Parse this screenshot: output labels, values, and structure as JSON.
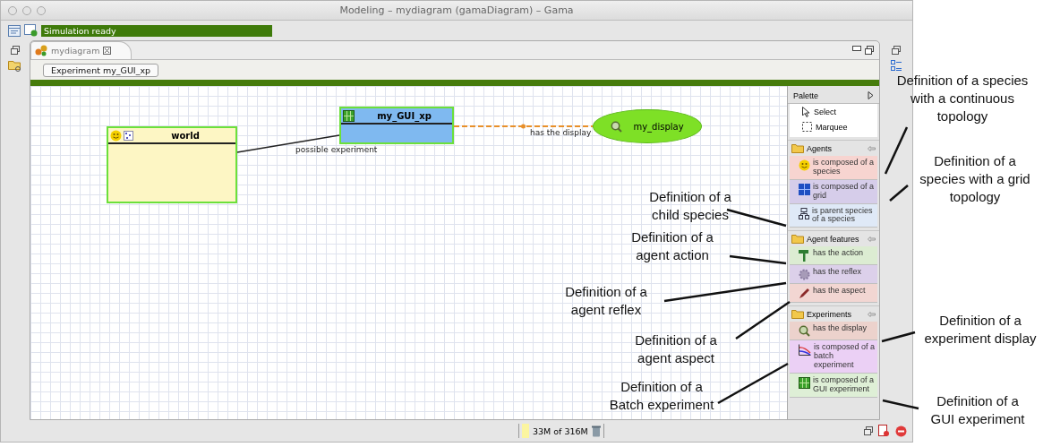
{
  "window": {
    "title": "Modeling – mydiagram (gamaDiagram) – Gama"
  },
  "status": {
    "text": "Simulation ready"
  },
  "editor_tab": {
    "label": "mydiagram",
    "selected": true
  },
  "experiment_button": {
    "label": "Experiment my_GUI_xp"
  },
  "diagram": {
    "nodes": [
      {
        "kind": "species",
        "label": "world"
      },
      {
        "kind": "experiment",
        "label": "my_GUI_xp"
      },
      {
        "kind": "display",
        "label": "my_display"
      }
    ],
    "edges": [
      {
        "kind": "solid",
        "label": "possible experiment"
      },
      {
        "kind": "dashed",
        "label": "has the display"
      }
    ]
  },
  "palette": {
    "title": "Palette",
    "tools": [
      {
        "kind": "select",
        "label": "Select"
      },
      {
        "kind": "marquee",
        "label": "Marquee"
      }
    ],
    "drawers": [
      {
        "title": "Agents",
        "items": [
          {
            "kind": "smiley",
            "label": "is composed of a species",
            "color": "#f7d4d0"
          },
          {
            "kind": "grid",
            "label": "is composed of a grid",
            "color": "#d6cdea"
          },
          {
            "kind": "hierarchy",
            "label": "is parent species of a species",
            "color": "#dfe9f7"
          }
        ]
      },
      {
        "title": "Agent features",
        "items": [
          {
            "kind": "hammer",
            "label": "has the action",
            "color": "#dcecd2"
          },
          {
            "kind": "gear",
            "label": "has the reflex",
            "color": "#dcd0ea"
          },
          {
            "kind": "pencil",
            "label": "has the aspect",
            "color": "#f2d6d2"
          }
        ]
      },
      {
        "title": "Experiments",
        "items": [
          {
            "kind": "magnifier",
            "label": "has the display",
            "color": "#ecd2cc"
          },
          {
            "kind": "chart",
            "label": "is composed of a batch experiment",
            "color": "#ebd0f5"
          },
          {
            "kind": "gridgreen",
            "label": "is composed of a GUI experiment",
            "color": "#deefd6"
          }
        ]
      }
    ]
  },
  "memory": {
    "text": "33M of 316M"
  },
  "annotations": [
    {
      "text": "Definition of a species with a continuous topology"
    },
    {
      "text": "Definition of a species with a grid topology"
    },
    {
      "text": "Definition of a child species"
    },
    {
      "text": "Definition of a agent action"
    },
    {
      "text": "Definition of a agent reflex"
    },
    {
      "text": "Definition of a agent aspect"
    },
    {
      "text": "Definition of a Batch experiment"
    },
    {
      "text": "Definition of a experiment display"
    },
    {
      "text": "Definition of a GUI experiment"
    }
  ]
}
